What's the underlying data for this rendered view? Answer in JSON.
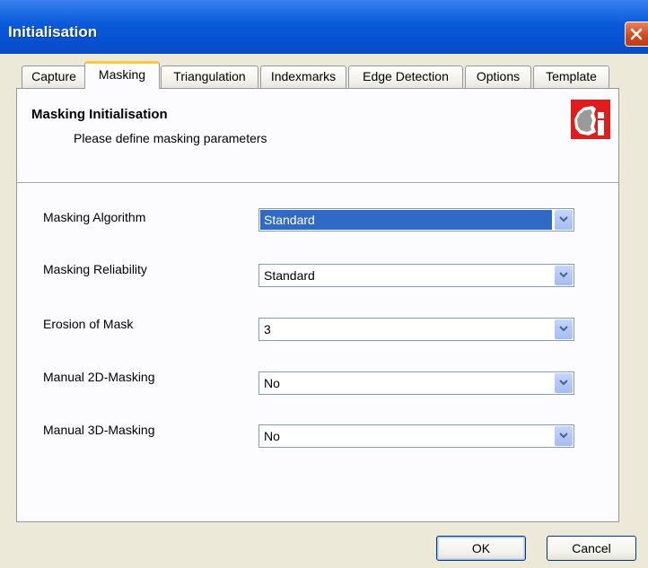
{
  "window": {
    "title": "Initialisation"
  },
  "tabs": [
    {
      "label": "Capture"
    },
    {
      "label": "Masking"
    },
    {
      "label": "Triangulation"
    },
    {
      "label": "Indexmarks"
    },
    {
      "label": "Edge Detection"
    },
    {
      "label": "Options"
    },
    {
      "label": "Template"
    }
  ],
  "active_tab": "Masking",
  "header": {
    "title": "Masking Initialisation",
    "subtitle": "Please define masking parameters",
    "icon": "info-badge-icon"
  },
  "fields": [
    {
      "label": "Masking Algorithm",
      "value": "Standard",
      "focused": true
    },
    {
      "label": "Masking Reliability",
      "value": "Standard"
    },
    {
      "label": "Erosion of Mask",
      "value": "3"
    },
    {
      "label": "Manual 2D-Masking",
      "value": "No"
    },
    {
      "label": "Manual 3D-Masking",
      "value": "No"
    }
  ],
  "buttons": {
    "ok": "OK",
    "cancel": "Cancel"
  },
  "colors": {
    "titlebar": "#0a5ad9",
    "selection": "#316ac5",
    "active_tab_accent": "#ffc83c",
    "icon_red": "#e21b1b"
  }
}
